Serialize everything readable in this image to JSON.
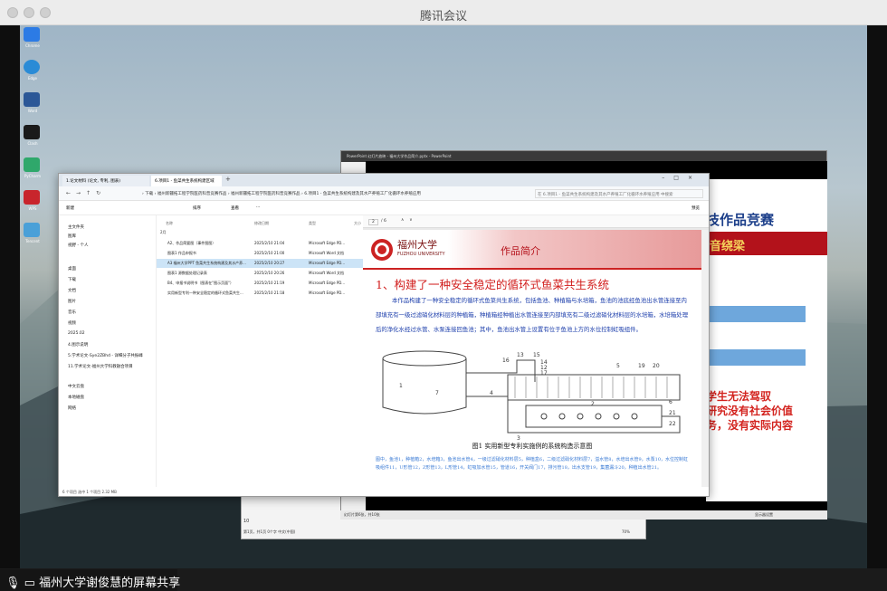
{
  "app_title": "腾讯会议",
  "share_label": "福州大学谢俊慧的屏幕共享",
  "desktop_icons": [
    "Chrome",
    "Edge",
    "Word",
    "Clash",
    "PyCharm",
    "WPS",
    "Tencent"
  ],
  "ppt": {
    "title": "PowerPoint 幻灯片放映 - 福州大学作品简介.pptx - PowerPoint",
    "slide_heading_partial": "技作品竞赛",
    "slide_band_partial": "音绕梁",
    "slide_red_lines": [
      "学生无法驾驭",
      "研究没有社会价值",
      "务，没有实际内容"
    ],
    "status_left": "幻灯片第6张，共10张",
    "status_right": "显示器设置"
  },
  "word": {
    "page_number": "10",
    "status": "第1页，共1页  0个字  中文(中国)",
    "zoom": "70%"
  },
  "explorer": {
    "tabs": [
      "1.论文材料 (论文, 专利, 图表)",
      "6.项目1 - 鱼菜共生系统构建区域"
    ],
    "breadcrumb": "› 下载 › 福州新疆拓工程学院医药科普竞赛作品 › 福州新疆拓工程学院医药科普竞赛作品 › 6.项目1 - 鱼菜共生系统构建及其水产养殖工厂化循环水养殖应用",
    "search_placeholder": "在 6.项目1 - 鱼菜共生系统构建及其水产养殖工厂化循环水养殖应用 中搜索",
    "toolbar": {
      "new": "新建",
      "sort": "排序",
      "view": "查看",
      "more": "···",
      "preview": "预览"
    },
    "nav": [
      "主文件夹",
      "图库",
      "视野 - 个人",
      "桌面",
      "下载",
      "文档",
      "图片",
      "音乐",
      "视频",
      "2025.02",
      "4.图示说明",
      "5.学术论文-Sye2ZBhd - 详细分子共振峰",
      "11.学术论文-福州大学科教融合项目",
      "中文云盘",
      "本地磁盘",
      "网络"
    ],
    "columns": [
      "名称",
      "修改日期",
      "类型",
      "大小"
    ],
    "group": "2月",
    "files": [
      {
        "name": "A2、作品简要图（事件图图）",
        "date": "2025/2/10 21:04",
        "type": "Microsoft Edge PD..."
      },
      {
        "name": "图表1 作品申报书",
        "date": "2025/2/10 21:00",
        "type": "Microsoft Word 文档"
      },
      {
        "name": "A3 福州大学PPT 鱼菜共生系统构建及其水产养...",
        "date": "2025/2/10 20:27",
        "type": "Microsoft Edge PD...",
        "selected": true
      },
      {
        "name": "图表1 源数据处理记录表",
        "date": "2025/2/10 20:26",
        "type": "Microsoft Word 文档"
      },
      {
        "name": "B4、申报书说明书（图表在\"图示页面\"）",
        "date": "2025/2/10 21:19",
        "type": "Microsoft Edge PD..."
      },
      {
        "name": "实用新型专利一种安全稳定的循环式鱼菜共生...",
        "date": "2025/2/10 21:18",
        "type": "Microsoft Edge PD..."
      }
    ],
    "status": "6 个项目    选中 1 个项目 2.32 MB",
    "pdf_page": "2",
    "pdf_pages": "/ 6"
  },
  "doc": {
    "univ_cn": "福州大学",
    "univ_en": "FUZHOU UNIVERSITY",
    "header_title": "作品简介",
    "heading": "1、构建了一种安全稳定的循环式鱼菜共生系统",
    "paragraph": "本作品构建了一种安全稳定的循环式鱼菜共生系统，包括鱼池、种植箱与水培箱，鱼池的池底经鱼池出水管连接至内部填充有一级过滤硝化材料层的种植箱，种植箱经种植出水管连接至内部填充有二级过滤硝化材料层的水培箱，水培箱处理后的净化水经过水管、水泵连接回鱼池；其中，鱼池出水管上设置有位于鱼池上方的水位控制虹吸组件。",
    "figure_caption": "图1 实用新型专利实施例的系统构造示意图",
    "figure_labels": [
      "13",
      "15",
      "14",
      "12",
      "17",
      "16",
      "20",
      "19",
      "5",
      "2",
      "7",
      "6",
      "4",
      "3",
      "1",
      "21",
      "22"
    ],
    "legend": "图中，鱼池1，种植箱2，水培箱3，鱼池出水管4，一级过滤硝化材料层5，种植盒6，二级过滤硝化材料层7，溢水管8，水培出水管9，水泵10，水位控制虹吸组件11，U形管12，Z形管13，L形管14，虹吸加水管15，管道16，开关阀门17，排污管18，出水支管19，集菌漏斗20，种植出水管21。"
  }
}
